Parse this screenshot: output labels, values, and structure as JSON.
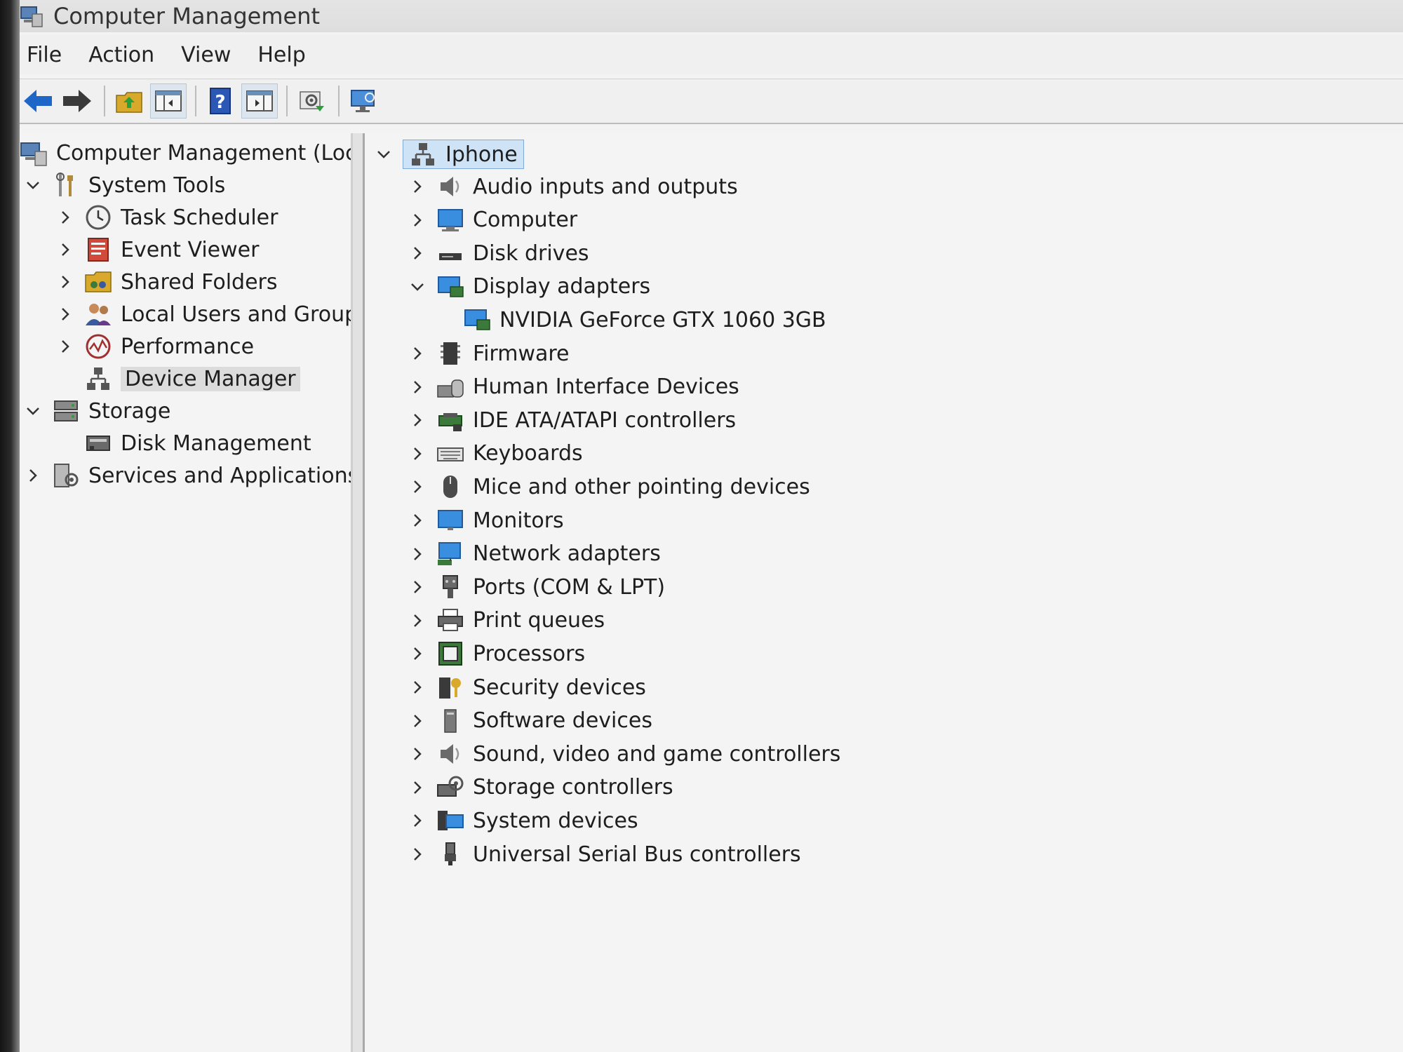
{
  "window": {
    "title": "Computer Management"
  },
  "menu": {
    "items": [
      "File",
      "Action",
      "View",
      "Help"
    ]
  },
  "toolbar": {
    "buttons": [
      {
        "icon": "back-arrow-icon"
      },
      {
        "icon": "forward-arrow-icon"
      },
      {
        "icon": "up-folder-icon"
      },
      {
        "icon": "show-hide-console-tree-icon",
        "pressed": true
      },
      {
        "icon": "help-icon"
      },
      {
        "icon": "show-hide-action-pane-icon",
        "pressed": true
      },
      {
        "icon": "properties-gear-icon"
      },
      {
        "icon": "scan-hardware-monitor-icon"
      }
    ]
  },
  "left_tree": {
    "root": "Computer Management (Local",
    "items": [
      {
        "label": "System Tools",
        "expanded": true,
        "icon": "system-tools-icon"
      },
      {
        "label": "Task Scheduler",
        "icon": "clock-icon"
      },
      {
        "label": "Event Viewer",
        "icon": "event-viewer-icon"
      },
      {
        "label": "Shared Folders",
        "icon": "shared-folder-icon"
      },
      {
        "label": "Local Users and Groups",
        "icon": "users-icon"
      },
      {
        "label": "Performance",
        "icon": "performance-icon"
      },
      {
        "label": "Device Manager",
        "icon": "device-manager-icon",
        "selected": true
      },
      {
        "label": "Storage",
        "expanded": true,
        "icon": "storage-icon"
      },
      {
        "label": "Disk Management",
        "icon": "disk-management-icon"
      },
      {
        "label": "Services and Applications",
        "icon": "services-icon"
      }
    ]
  },
  "device_tree": {
    "root": "Iphone",
    "categories": [
      {
        "label": "Audio inputs and outputs",
        "icon": "speaker-icon"
      },
      {
        "label": "Computer",
        "icon": "computer-icon"
      },
      {
        "label": "Disk drives",
        "icon": "disk-drive-icon"
      },
      {
        "label": "Display adapters",
        "icon": "display-adapter-icon",
        "expanded": true
      },
      {
        "label": "NVIDIA GeForce GTX 1060 3GB",
        "icon": "display-adapter-icon",
        "child": true
      },
      {
        "label": "Firmware",
        "icon": "firmware-icon"
      },
      {
        "label": "Human Interface Devices",
        "icon": "hid-icon"
      },
      {
        "label": "IDE ATA/ATAPI controllers",
        "icon": "ide-controller-icon"
      },
      {
        "label": "Keyboards",
        "icon": "keyboard-icon"
      },
      {
        "label": "Mice and other pointing devices",
        "icon": "mouse-icon"
      },
      {
        "label": "Monitors",
        "icon": "monitor-icon"
      },
      {
        "label": "Network adapters",
        "icon": "network-adapter-icon"
      },
      {
        "label": "Ports (COM & LPT)",
        "icon": "port-icon"
      },
      {
        "label": "Print queues",
        "icon": "printer-icon"
      },
      {
        "label": "Processors",
        "icon": "processor-icon"
      },
      {
        "label": "Security devices",
        "icon": "security-device-icon"
      },
      {
        "label": "Software devices",
        "icon": "software-device-icon"
      },
      {
        "label": "Sound, video and game controllers",
        "icon": "speaker-icon"
      },
      {
        "label": "Storage controllers",
        "icon": "storage-controller-icon"
      },
      {
        "label": "System devices",
        "icon": "system-device-icon"
      },
      {
        "label": "Universal Serial Bus controllers",
        "icon": "usb-icon"
      }
    ]
  },
  "colors": {
    "selection": "#dcdcdc",
    "root_highlight": "#cfe3f7",
    "icon_blue": "#2f7fd3",
    "arrow_blue": "#1f66c9"
  }
}
